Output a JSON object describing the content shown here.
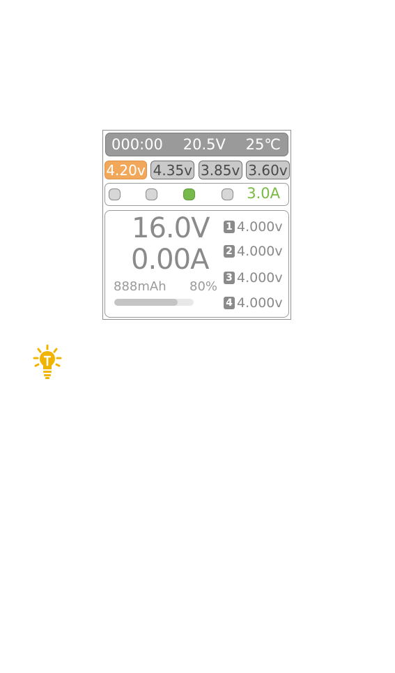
{
  "status": {
    "timer": "000:00",
    "input_voltage": "20.5V",
    "temperature": "25℃"
  },
  "voltage_presets": [
    {
      "label": "4.20v",
      "active": true
    },
    {
      "label": "4.35v",
      "active": false
    },
    {
      "label": "3.85v",
      "active": false
    },
    {
      "label": "3.60v",
      "active": false
    }
  ],
  "channel_indicators": {
    "states": [
      "off",
      "off",
      "on",
      "off"
    ],
    "current": "3.0A"
  },
  "readout": {
    "voltage": "16.0V",
    "amperage": "0.00A",
    "capacity": "888mAh",
    "percent": "80%",
    "progress": 0.8
  },
  "cells": [
    {
      "num": "1",
      "value": "4.000v"
    },
    {
      "num": "2",
      "value": "4.000v"
    },
    {
      "num": "3",
      "value": "4.000v"
    },
    {
      "num": "4",
      "value": "4.000v"
    }
  ],
  "colors": {
    "active_preset": "#f2a85a",
    "indicator_on": "#77b94a",
    "current_text": "#79b944",
    "tip_icon": "#f0b400"
  },
  "icons": {
    "tip": "lightbulb-icon"
  }
}
